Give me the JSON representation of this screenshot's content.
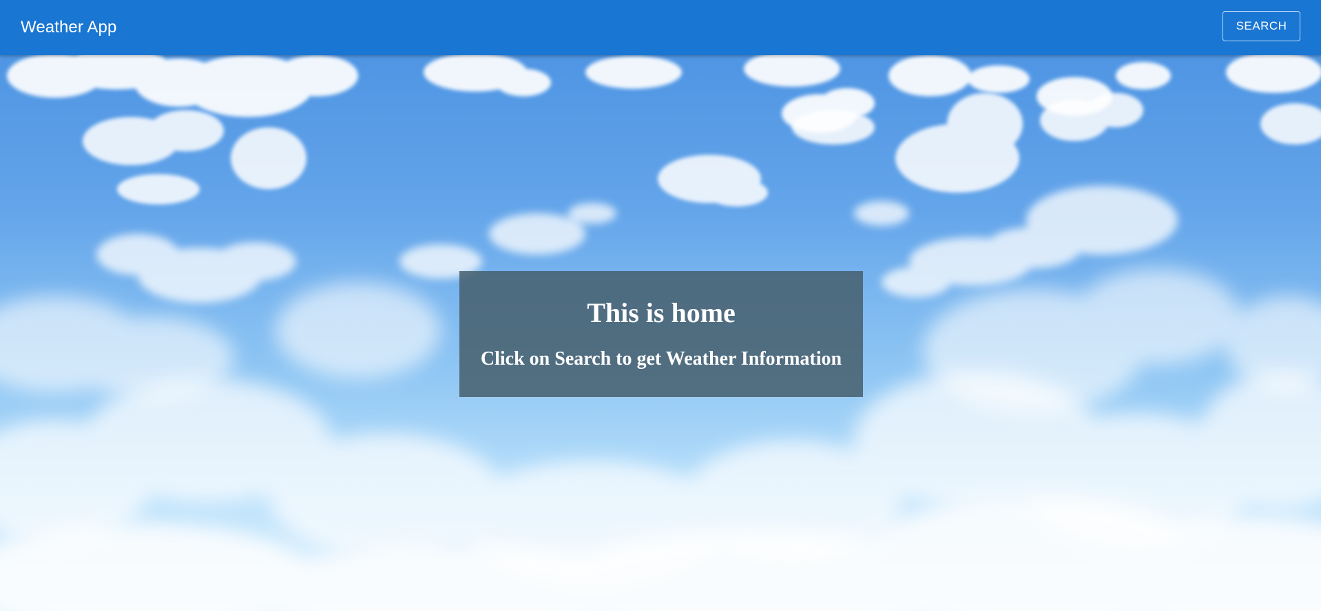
{
  "appbar": {
    "title": "Weather App",
    "search_label": "SEARCH",
    "color": "#1976d2"
  },
  "home": {
    "title": "This is home",
    "subtitle": "Click on Search to get Weather Information"
  },
  "background": {
    "description_icon": "cloudy-sky-background"
  }
}
